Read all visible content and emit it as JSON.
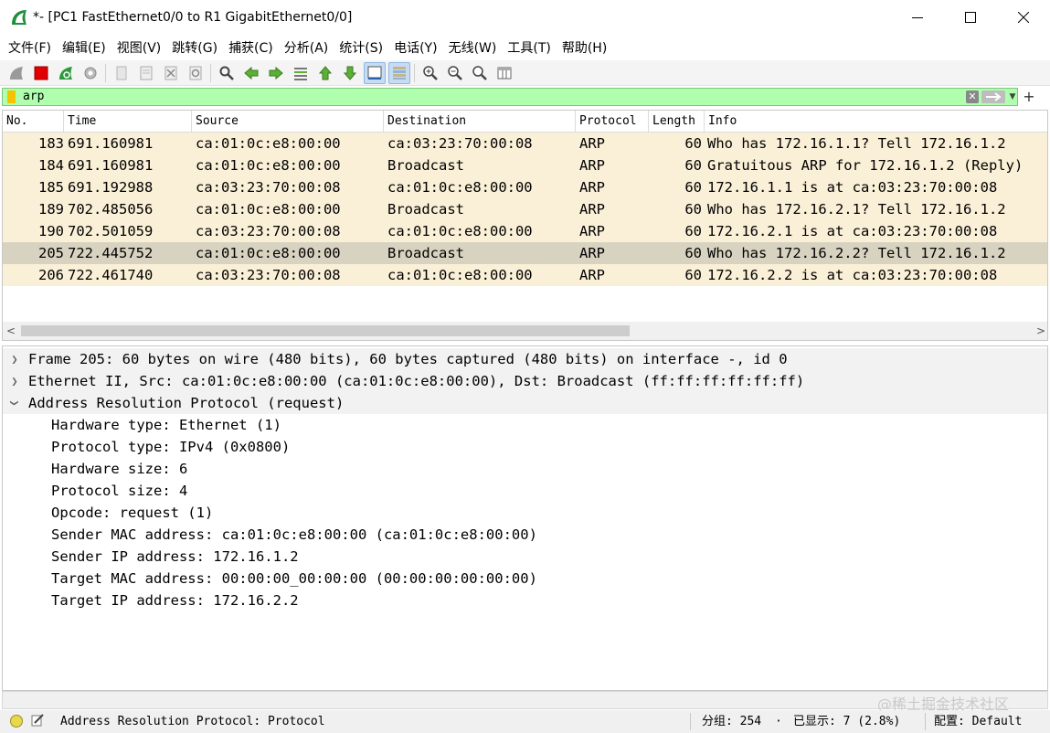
{
  "window": {
    "title": "*- [PC1 FastEthernet0/0 to R1 GigabitEthernet0/0]",
    "icon": "wireshark-fin-icon",
    "controls": [
      "minimize-icon",
      "maximize-icon",
      "close-icon"
    ]
  },
  "menu": [
    {
      "label": "文件(F)"
    },
    {
      "label": "编辑(E)"
    },
    {
      "label": "视图(V)"
    },
    {
      "label": "跳转(G)"
    },
    {
      "label": "捕获(C)"
    },
    {
      "label": "分析(A)"
    },
    {
      "label": "统计(S)"
    },
    {
      "label": "电话(Y)"
    },
    {
      "label": "无线(W)"
    },
    {
      "label": "工具(T)"
    },
    {
      "label": "帮助(H)"
    }
  ],
  "filter": {
    "value": "arp",
    "clear_icon": "✕",
    "plus": "+",
    "color": "#afffaf"
  },
  "packet_list": {
    "columns": [
      "No.",
      "Time",
      "Source",
      "Destination",
      "Protocol",
      "Length",
      "Info"
    ],
    "rows": [
      {
        "no": "183",
        "time": "691.160981",
        "source": "ca:01:0c:e8:00:00",
        "destination": "ca:03:23:70:00:08",
        "protocol": "ARP",
        "length": "60",
        "info": "Who has 172.16.1.1? Tell 172.16.1.2"
      },
      {
        "no": "184",
        "time": "691.160981",
        "source": "ca:01:0c:e8:00:00",
        "destination": "Broadcast",
        "protocol": "ARP",
        "length": "60",
        "info": "Gratuitous ARP for 172.16.1.2 (Reply)"
      },
      {
        "no": "185",
        "time": "691.192988",
        "source": "ca:03:23:70:00:08",
        "destination": "ca:01:0c:e8:00:00",
        "protocol": "ARP",
        "length": "60",
        "info": "172.16.1.1 is at ca:03:23:70:00:08"
      },
      {
        "no": "189",
        "time": "702.485056",
        "source": "ca:01:0c:e8:00:00",
        "destination": "Broadcast",
        "protocol": "ARP",
        "length": "60",
        "info": "Who has 172.16.2.1? Tell 172.16.1.2"
      },
      {
        "no": "190",
        "time": "702.501059",
        "source": "ca:03:23:70:00:08",
        "destination": "ca:01:0c:e8:00:00",
        "protocol": "ARP",
        "length": "60",
        "info": "172.16.2.1 is at ca:03:23:70:00:08"
      },
      {
        "no": "205",
        "time": "722.445752",
        "source": "ca:01:0c:e8:00:00",
        "destination": "Broadcast",
        "protocol": "ARP",
        "length": "60",
        "info": "Who has 172.16.2.2? Tell 172.16.1.2"
      },
      {
        "no": "206",
        "time": "722.461740",
        "source": "ca:03:23:70:00:08",
        "destination": "ca:01:0c:e8:00:00",
        "protocol": "ARP",
        "length": "60",
        "info": "172.16.2.2 is at ca:03:23:70:00:08"
      }
    ],
    "row_color": "#faf0d7",
    "selected_color": "#d8d3c0"
  },
  "details": {
    "frame": "Frame 205: 60 bytes on wire (480 bits), 60 bytes captured (480 bits) on interface -, id 0",
    "ethernet": "Ethernet II, Src: ca:01:0c:e8:00:00 (ca:01:0c:e8:00:00), Dst: Broadcast (ff:ff:ff:ff:ff:ff)",
    "arp": "Address Resolution Protocol (request)",
    "arp_fields": [
      "Hardware type: Ethernet (1)",
      "Protocol type: IPv4 (0x0800)",
      "Hardware size: 6",
      "Protocol size: 4",
      "Opcode: request (1)",
      "Sender MAC address: ca:01:0c:e8:00:00 (ca:01:0c:e8:00:00)",
      "Sender IP address: 172.16.1.2",
      "Target MAC address: 00:00:00_00:00:00 (00:00:00:00:00:00)",
      "Target IP address: 172.16.2.2"
    ]
  },
  "status": {
    "field": "Address Resolution Protocol: Protocol",
    "packets": "分组: 254",
    "sep": "·",
    "displayed": "已显示: 7 (2.8%)",
    "profile": "配置: Default",
    "watermark": "@稀土掘金技术社区"
  }
}
